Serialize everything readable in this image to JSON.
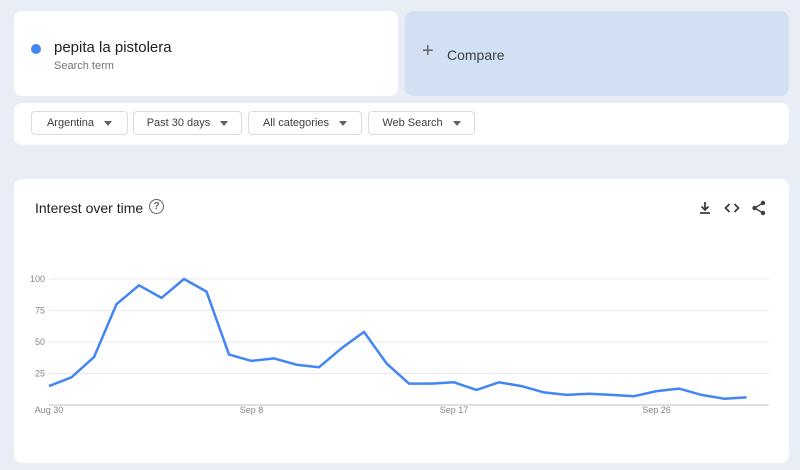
{
  "search_term": {
    "name": "pepita la pistolera",
    "subtitle": "Search term",
    "color": "#4285f4"
  },
  "compare": {
    "icon": "+",
    "label": "Compare"
  },
  "filters": {
    "region": "Argentina",
    "time": "Past 30 days",
    "category": "All categories",
    "search_type": "Web Search"
  },
  "chart_panel": {
    "title": "Interest over time",
    "help": "?",
    "actions": [
      "download-icon",
      "embed-code-icon",
      "share-icon"
    ]
  },
  "chart_data": {
    "type": "line",
    "title": "Interest over time",
    "xlabel": "",
    "ylabel": "",
    "ylim": [
      0,
      100
    ],
    "y_ticks": [
      "25",
      "50",
      "75",
      "100"
    ],
    "x_tick_labels": [
      "Aug 30",
      "Sep 8",
      "Sep 17",
      "Sep 26"
    ],
    "x_tick_indices": [
      0,
      9,
      18,
      27
    ],
    "grid": true,
    "series": [
      {
        "color": "#4285f4",
        "x": [
          "Aug 30",
          "Aug 31",
          "Sep 1",
          "Sep 2",
          "Sep 3",
          "Sep 4",
          "Sep 5",
          "Sep 6",
          "Sep 7",
          "Sep 8",
          "Sep 9",
          "Sep 10",
          "Sep 11",
          "Sep 12",
          "Sep 13",
          "Sep 14",
          "Sep 15",
          "Sep 16",
          "Sep 17",
          "Sep 18",
          "Sep 19",
          "Sep 20",
          "Sep 21",
          "Sep 22",
          "Sep 23",
          "Sep 24",
          "Sep 25",
          "Sep 26",
          "Sep 27",
          "Sep 28",
          "Sep 29",
          "Sep 30",
          "Oct 1"
        ],
        "values": [
          15,
          22,
          38,
          80,
          95,
          85,
          100,
          90,
          40,
          35,
          37,
          32,
          30,
          45,
          58,
          33,
          17,
          17,
          18,
          12,
          18,
          15,
          10,
          8,
          9,
          8,
          7,
          11,
          13,
          8,
          5,
          6,
          null
        ]
      }
    ]
  }
}
